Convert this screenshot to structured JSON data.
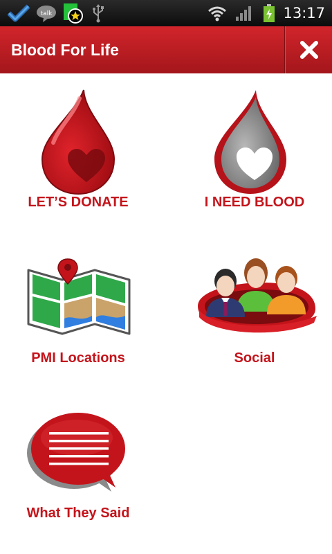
{
  "status_bar": {
    "time": "13:17",
    "talk_label": "talk",
    "icons": [
      "foursquare-icon",
      "talk-icon",
      "star-notification-icon",
      "usb-icon",
      "wifi-icon",
      "signal-icon",
      "battery-icon"
    ]
  },
  "app_bar": {
    "title": "Blood For Life",
    "close_icon": "close-icon"
  },
  "menu": {
    "donate": {
      "label": "LET’S DONATE",
      "icon": "blood-drop-red-icon"
    },
    "need_blood": {
      "label": "I NEED BLOOD",
      "icon": "blood-drop-grey-icon"
    },
    "locations": {
      "label": "PMI Locations",
      "icon": "map-icon"
    },
    "social": {
      "label": "Social",
      "icon": "people-icon"
    },
    "testimonials": {
      "label": "What They Said",
      "icon": "speech-bubble-icon"
    }
  },
  "colors": {
    "brand_red": "#c4141b",
    "app_bar_top": "#d1252b",
    "app_bar_bottom": "#a3161b",
    "status_bar": "#121212"
  }
}
